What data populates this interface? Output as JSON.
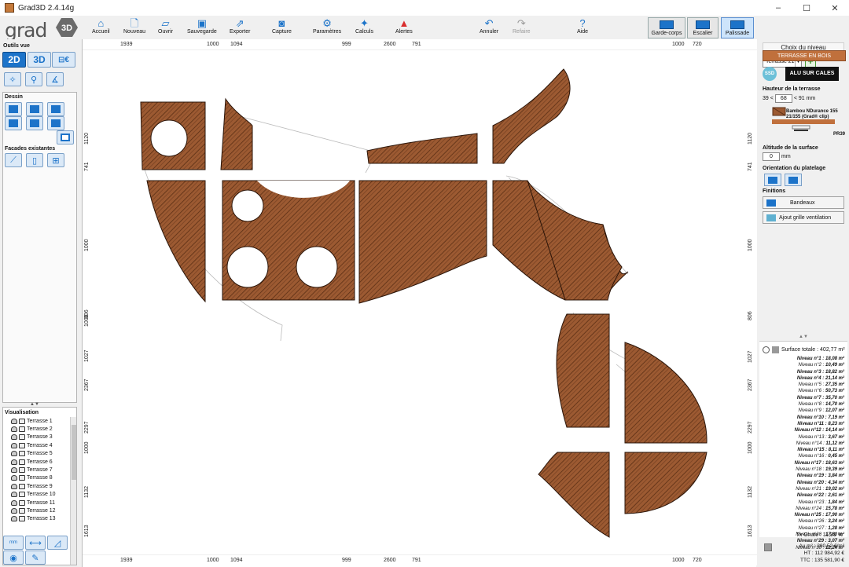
{
  "window": {
    "title": "Grad3D 2.4.14g",
    "controls": [
      "–",
      "☐",
      "✕"
    ]
  },
  "logo": {
    "text": "grad",
    "badge": "3D"
  },
  "toolbar": {
    "items": [
      {
        "id": "accueil",
        "label": "Accueil",
        "icon": "home-icon"
      },
      {
        "id": "nouveau",
        "label": "Nouveau",
        "icon": "new-file-icon"
      },
      {
        "id": "ouvrir",
        "label": "Ouvrir",
        "icon": "open-folder-icon"
      },
      {
        "id": "sauvegarde",
        "label": "Sauvegarde",
        "icon": "save-icon"
      },
      {
        "id": "exporter",
        "label": "Exporter",
        "icon": "export-icon"
      },
      {
        "id": "capture",
        "label": "Capture",
        "icon": "camera-icon"
      },
      {
        "id": "parametres",
        "label": "Paramètres",
        "icon": "settings-icon"
      },
      {
        "id": "calculs",
        "label": "Calculs",
        "icon": "calculs-icon"
      },
      {
        "id": "alertes",
        "label": "Alertes",
        "icon": "warning-icon"
      },
      {
        "id": "annuler",
        "label": "Annuler",
        "icon": "undo-icon"
      },
      {
        "id": "refaire",
        "label": "Refaire",
        "icon": "redo-icon"
      },
      {
        "id": "aide",
        "label": "Aide",
        "icon": "help-icon"
      }
    ],
    "big_buttons": [
      {
        "id": "garde-corps",
        "label": "Garde-corps"
      },
      {
        "id": "escalier",
        "label": "Escalier"
      },
      {
        "id": "palissade",
        "label": "Palissade"
      }
    ]
  },
  "left_panel": {
    "outils_vue": "Outils vue",
    "view_2d": "2D",
    "view_3d": "3D",
    "dessin": "Dessin",
    "facades": "Facades existantes",
    "visualisation": "Visualisation",
    "terrasses": [
      "Terrasse 1",
      "Terrasse 2",
      "Terrasse 3",
      "Terrasse 4",
      "Terrasse 5",
      "Terrasse 6",
      "Terrasse 7",
      "Terrasse 8",
      "Terrasse 9",
      "Terrasse 10",
      "Terrasse 11",
      "Terrasse 12",
      "Terrasse 13"
    ],
    "unit_btn": "mm"
  },
  "rulers": {
    "top": [
      "1939",
      "1000",
      "1094",
      "999",
      "2600",
      "791",
      "1000",
      "720"
    ],
    "bottom": [
      "1939",
      "1000",
      "1094",
      "999",
      "2600",
      "791",
      "1000",
      "720"
    ],
    "left": [
      "1120",
      "741",
      "1000",
      "1000",
      "806",
      "1027",
      "2367",
      "2297",
      "1000",
      "1132",
      "1613"
    ],
    "right": [
      "1120",
      "741",
      "1000",
      "806",
      "1027",
      "2367",
      "2297",
      "1000",
      "1132",
      "1613"
    ]
  },
  "right_panel": {
    "choix_niveau": "Choix du niveau",
    "selected_level": "Terrasse 21",
    "add_label": "+",
    "terrasse_bois": "TERRASSE EN BOIS",
    "ssd": "SSD",
    "alu": "ALU SUR CALES",
    "hauteur_label": "Hauteur de la terrasse",
    "hauteur_min": "39 <",
    "hauteur_val": "68",
    "hauteur_max": "< 91 mm",
    "product_name": "Bambou NDurance 155 21/155 (Grad® clip)",
    "product_code": "PR39",
    "altitude_label": "Altitude de la surface",
    "altitude_val": "0",
    "altitude_unit": "mm",
    "orientation_label": "Orientation du platelage",
    "finitions_label": "Finitions",
    "bandeaux": "Bandeaux",
    "grille": "Ajout grille ventilation"
  },
  "surfaces": {
    "total_label": "Surface totale : 402,77 m²",
    "levels": [
      {
        "name": "Niveau n°1 :",
        "value": "18,08 m²",
        "bold": true
      },
      {
        "name": "Niveau n°2 :",
        "value": "10,49 m²",
        "bold": false
      },
      {
        "name": "Niveau n°3 :",
        "value": "18,82 m²",
        "bold": true
      },
      {
        "name": "Niveau n°4 :",
        "value": "21,14 m²",
        "bold": true
      },
      {
        "name": "Niveau n°5 :",
        "value": "27,35 m²",
        "bold": false
      },
      {
        "name": "Niveau n°6 :",
        "value": "50,73 m²",
        "bold": false
      },
      {
        "name": "Niveau n°7 :",
        "value": "35,70 m²",
        "bold": true
      },
      {
        "name": "Niveau n°8 :",
        "value": "14,70 m²",
        "bold": false
      },
      {
        "name": "Niveau n°9 :",
        "value": "12,07 m²",
        "bold": false
      },
      {
        "name": "Niveau n°10 :",
        "value": "7,19 m²",
        "bold": true
      },
      {
        "name": "Niveau n°11 :",
        "value": "8,23 m²",
        "bold": true
      },
      {
        "name": "Niveau n°12 :",
        "value": "14,14 m²",
        "bold": true
      },
      {
        "name": "Niveau n°13 :",
        "value": "3,67 m²",
        "bold": false
      },
      {
        "name": "Niveau n°14 :",
        "value": "11,12 m²",
        "bold": false
      },
      {
        "name": "Niveau n°15 :",
        "value": "8,11 m²",
        "bold": true
      },
      {
        "name": "Niveau n°16 :",
        "value": "0,45 m²",
        "bold": false
      },
      {
        "name": "Niveau n°17 :",
        "value": "18,63 m²",
        "bold": true
      },
      {
        "name": "Niveau n°18 :",
        "value": "19,39 m²",
        "bold": false
      },
      {
        "name": "Niveau n°19 :",
        "value": "3,84 m²",
        "bold": true
      },
      {
        "name": "Niveau n°20 :",
        "value": "4,34 m²",
        "bold": true
      },
      {
        "name": "Niveau n°21 :",
        "value": "19,02 m²",
        "bold": false
      },
      {
        "name": "Niveau n°22 :",
        "value": "2,61 m²",
        "bold": true
      },
      {
        "name": "Niveau n°23 :",
        "value": "1,84 m²",
        "bold": false
      },
      {
        "name": "Niveau n°24 :",
        "value": "15,78 m²",
        "bold": false
      },
      {
        "name": "Niveau n°25 :",
        "value": "17,90 m²",
        "bold": true
      },
      {
        "name": "Niveau n°26 :",
        "value": "3,24 m²",
        "bold": false
      },
      {
        "name": "Niveau n°27 :",
        "value": "1,28 m²",
        "bold": false
      },
      {
        "name": "Niveau n°28 :",
        "value": "17,60 m²",
        "bold": false
      },
      {
        "name": "Niveau n°29 :",
        "value": "3,07 m²",
        "bold": true
      },
      {
        "name": "Niveau n°30 :",
        "value": "12,24 m²",
        "bold": false
      }
    ],
    "chute": "Tx Chute : 11,81 %",
    "au_m2": "Au m² : 280,52 €/m²",
    "ht": "HT : 112 984,92 €",
    "ttc": "TTC : 135 581,90 €"
  },
  "colors": {
    "wood": "#9c5a32",
    "wood_dark": "#5a2e14",
    "accent": "#1c73c9",
    "brand_orange": "#c0703c"
  }
}
